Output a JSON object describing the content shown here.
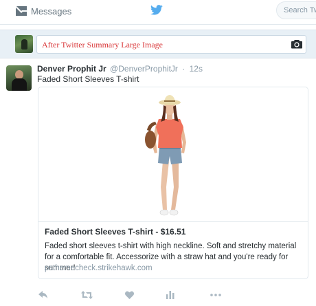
{
  "nav": {
    "messages_label": "Messages",
    "search_placeholder": "Search Twi"
  },
  "compose": {
    "text": "After Twitter Summary Large Image"
  },
  "tweet": {
    "author_name": "Denver Prophit Jr",
    "author_handle": "@DenverProphitJr",
    "separator": "·",
    "time": "12s",
    "text": "Faded Short Sleeves T-shirt"
  },
  "card": {
    "title": "Faded Short Sleeves T-shirt - $16.51",
    "description": "Faded short sleeves t-shirt with high neckline. Soft and stretchy material for a comfortable fit. Accessorize with a straw hat and you're ready for summer!",
    "link": "psthemecheck.strikehawk.com"
  },
  "colors": {
    "twitter_blue": "#55acee",
    "compose_text": "#d9383a",
    "muted": "#8899a6",
    "action_icon": "#aab8c2"
  },
  "icons": {
    "messages": "envelope-icon",
    "logo": "twitter-bird-icon",
    "camera": "camera-icon",
    "actions": [
      "reply-icon",
      "retweet-icon",
      "like-icon",
      "analytics-icon",
      "more-icon"
    ]
  }
}
